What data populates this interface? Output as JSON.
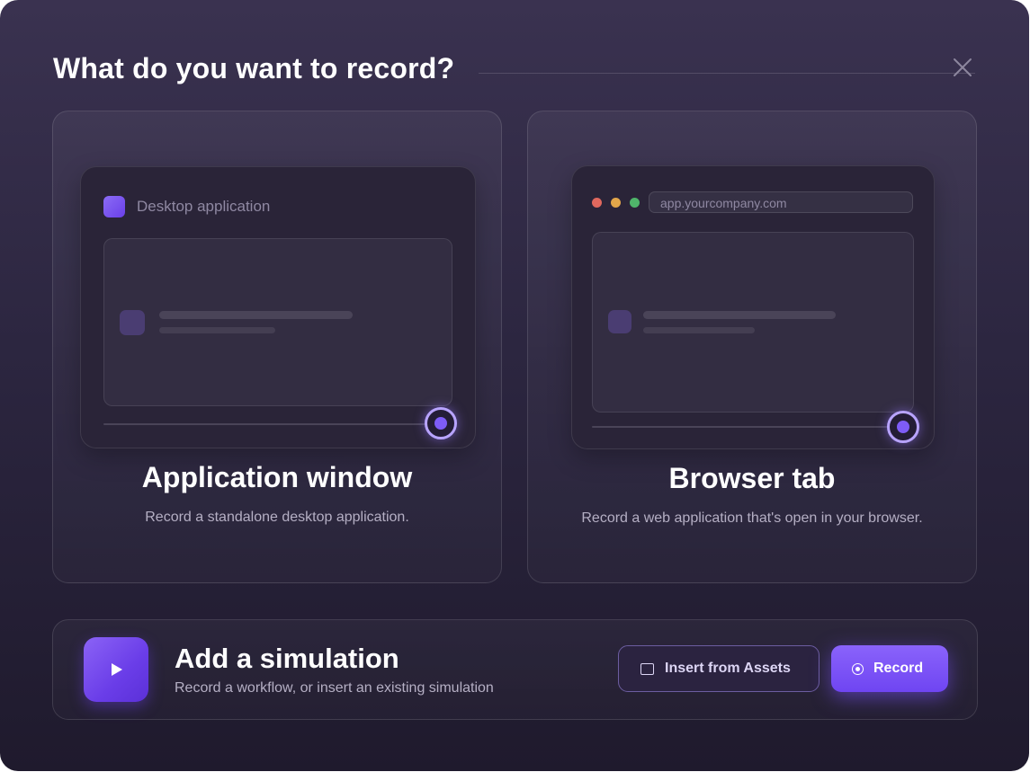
{
  "dialog": {
    "title": "What do you want to record?",
    "close_icon": "close-icon"
  },
  "options": [
    {
      "mock_label": "Desktop application",
      "title": "Application window",
      "description": "Record a standalone desktop application."
    },
    {
      "mock_url": "app.yourcompany.com",
      "title": "Browser tab",
      "description": "Record a web application that's open in your browser."
    }
  ],
  "simulation": {
    "icon": "play-icon",
    "title": "Add a simulation",
    "description": "Record a workflow, or insert an existing simulation",
    "insert_label": "Insert from Assets",
    "record_label": "Record"
  },
  "colors": {
    "accent": "#7b55f5",
    "traffic_red": "#e0685e",
    "traffic_yellow": "#e2a64a",
    "traffic_green": "#4fb56a"
  }
}
